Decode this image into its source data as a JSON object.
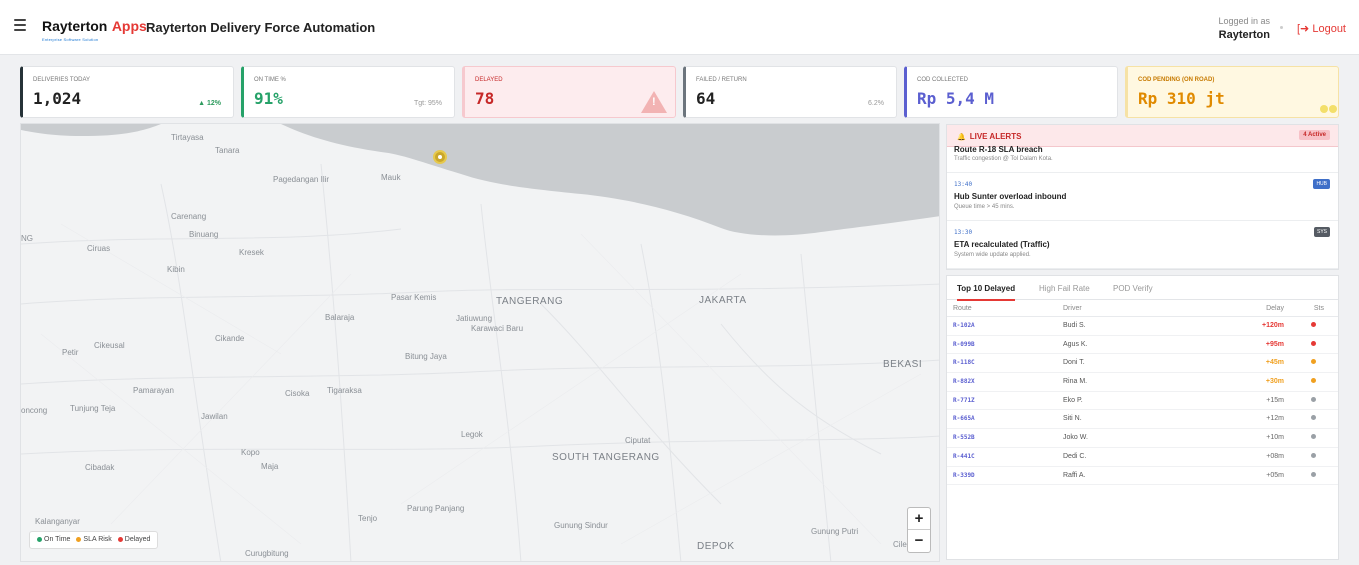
{
  "header": {
    "brand_main": "Rayterton",
    "brand_accent": "Apps",
    "brand_tagline": "Enterprise Software Solution",
    "title": "Rayterton Delivery Force Automation",
    "logged_label": "Logged in as",
    "user": "Rayterton",
    "logout": "Logout"
  },
  "kpis": [
    {
      "label": "DELIVERIES TODAY",
      "value": "1,024",
      "sub": "▲ 12%",
      "color": "#263238"
    },
    {
      "label": "ON TIME %",
      "value": "91%",
      "sub": "Tgt: 95%",
      "color": "#26a269"
    },
    {
      "label": "DELAYED",
      "value": "78",
      "sub": "",
      "color": "#e53935"
    },
    {
      "label": "FAILED / RETURN",
      "value": "64",
      "sub": "6.2%",
      "color": "#6c757d"
    },
    {
      "label": "COD COLLECTED",
      "value": "Rp 5,4 M",
      "sub": "",
      "color": "#5b5fd0"
    },
    {
      "label": "COD PENDING (ON ROAD)",
      "value": "Rp 310 jt",
      "sub": "",
      "color": "#f0a020"
    }
  ],
  "map": {
    "labels": [
      "Tirtayasa",
      "Tanara",
      "Mauk",
      "Pagedangan Ilir",
      "Carenang",
      "Binuang",
      "NG",
      "Ciruas",
      "Kresek",
      "Kibin",
      "Pasar Kemis",
      "TANGERANG",
      "JAKARTA",
      "Balaraja",
      "Jatiuwung",
      "Karawaci Baru",
      "Cikande",
      "Petir",
      "Cikeusal",
      "Bitung Jaya",
      "BEKASI",
      "Pamarayan",
      "Cisoka",
      "Tigaraksa",
      "oncong",
      "Tunjung Teja",
      "Jawilan",
      "Legok",
      "Ciputat",
      "Kopo",
      "Maja",
      "SOUTH TANGERANG",
      "Cibadak",
      "Tenjo",
      "Parung Panjang",
      "Kalanganyar",
      "Gunung Sindur",
      "Gunung Putri",
      "Curugbitung",
      "DEPOK",
      "Cile"
    ],
    "legend": [
      "On Time",
      "SLA Risk",
      "Delayed"
    ],
    "zoom_in": "+",
    "zoom_out": "−"
  },
  "alerts": {
    "title": "LIVE ALERTS",
    "count": "4 Active",
    "items": [
      {
        "time": "",
        "title": "Route R-18 SLA breach",
        "desc": "Traffic congestion @ Tol Dalam Kota.",
        "tag": ""
      },
      {
        "time": "13:40",
        "title": "Hub Sunter overload inbound",
        "desc": "Queue time > 45 mins.",
        "tag": "HUB"
      },
      {
        "time": "13:30",
        "title": "ETA recalculated (Traffic)",
        "desc": "System wide update applied.",
        "tag": "SYS"
      }
    ]
  },
  "table": {
    "tabs": [
      "Top 10 Delayed",
      "High Fail Rate",
      "POD Verify"
    ],
    "headers": [
      "Route",
      "Driver",
      "Delay",
      "Sts"
    ],
    "rows": [
      {
        "route": "R-102A",
        "driver": "Budi S.",
        "delay": "+120m",
        "status": "red"
      },
      {
        "route": "R-099B",
        "driver": "Agus K.",
        "delay": "+95m",
        "status": "red"
      },
      {
        "route": "R-118C",
        "driver": "Doni T.",
        "delay": "+45m",
        "status": "orange"
      },
      {
        "route": "R-882X",
        "driver": "Rina M.",
        "delay": "+30m",
        "status": "orange"
      },
      {
        "route": "R-771Z",
        "driver": "Eko P.",
        "delay": "+15m",
        "status": "gray"
      },
      {
        "route": "R-665A",
        "driver": "Siti N.",
        "delay": "+12m",
        "status": "gray"
      },
      {
        "route": "R-552B",
        "driver": "Joko W.",
        "delay": "+10m",
        "status": "gray"
      },
      {
        "route": "R-441C",
        "driver": "Dedi C.",
        "delay": "+08m",
        "status": "gray"
      },
      {
        "route": "R-339D",
        "driver": "Raffi A.",
        "delay": "+05m",
        "status": "gray"
      }
    ]
  },
  "colors": {
    "red": "#e53935",
    "orange": "#f0a020",
    "gray": "#9aa0a6",
    "green": "#26a269"
  }
}
